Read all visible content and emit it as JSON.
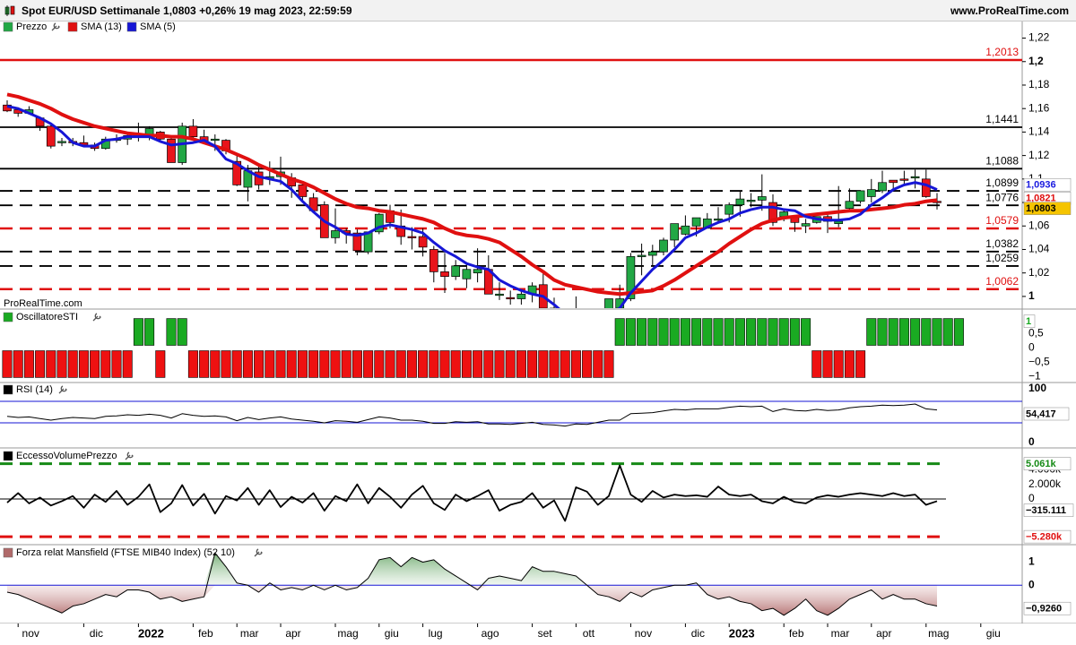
{
  "header": {
    "title": "Spot EUR/USD Settimanale 1,0803 +0,26% 19 mag 2023, 22:59:59",
    "site": "www.ProRealTime.com",
    "icon": "candlestick-icon"
  },
  "chart_data": [
    {
      "type": "candlestick",
      "panel": "price",
      "legend": [
        "Prezzo",
        "SMA (13)",
        "SMA (5)"
      ],
      "ylim": [
        0.99,
        1.225
      ],
      "y_ticks": [
        "1,22",
        "1,2",
        "1,18",
        "1,16",
        "1,14",
        "1,12",
        "1,1",
        "1,08",
        "1,06",
        "1,04",
        "1,02",
        "1"
      ],
      "y_tick_values": [
        1.22,
        1.2,
        1.18,
        1.16,
        1.14,
        1.12,
        1.1,
        1.08,
        1.06,
        1.04,
        1.02,
        1.0
      ],
      "x_labels": [
        "nov",
        "dic",
        "2022",
        "feb",
        "mar",
        "apr",
        "mag",
        "giu",
        "lug",
        "ago",
        "set",
        "ott",
        "nov",
        "dic",
        "2023",
        "feb",
        "mar",
        "apr",
        "mag",
        "giu"
      ],
      "x_label_weeks": [
        1,
        7,
        12,
        17,
        21,
        25,
        30,
        34,
        38,
        43,
        48,
        52,
        57,
        62,
        66,
        71,
        75,
        79,
        84,
        89
      ],
      "candles": [
        [
          1.163,
          1.167,
          1.157,
          1.158
        ],
        [
          1.159,
          1.161,
          1.153,
          1.156
        ],
        [
          1.156,
          1.162,
          1.155,
          1.159
        ],
        [
          1.152,
          1.153,
          1.141,
          1.145
        ],
        [
          1.145,
          1.146,
          1.126,
          1.128
        ],
        [
          1.131,
          1.135,
          1.128,
          1.132
        ],
        [
          1.132,
          1.135,
          1.128,
          1.131
        ],
        [
          1.131,
          1.137,
          1.127,
          1.129
        ],
        [
          1.129,
          1.131,
          1.124,
          1.126
        ],
        [
          1.126,
          1.136,
          1.125,
          1.134
        ],
        [
          1.133,
          1.138,
          1.131,
          1.134
        ],
        [
          1.134,
          1.139,
          1.129,
          1.137
        ],
        [
          1.137,
          1.148,
          1.132,
          1.136
        ],
        [
          1.136,
          1.145,
          1.133,
          1.143
        ],
        [
          1.14,
          1.141,
          1.132,
          1.134
        ],
        [
          1.134,
          1.136,
          1.119,
          1.114
        ],
        [
          1.114,
          1.148,
          1.112,
          1.145
        ],
        [
          1.145,
          1.151,
          1.134,
          1.136
        ],
        [
          1.136,
          1.142,
          1.13,
          1.132
        ],
        [
          1.133,
          1.138,
          1.124,
          1.134
        ],
        [
          1.133,
          1.134,
          1.121,
          1.124
        ],
        [
          1.115,
          1.121,
          1.094,
          1.095
        ],
        [
          1.093,
          1.112,
          1.081,
          1.107
        ],
        [
          1.106,
          1.111,
          1.091,
          1.095
        ],
        [
          1.1,
          1.115,
          1.095,
          1.102
        ],
        [
          1.102,
          1.119,
          1.095,
          1.106
        ],
        [
          1.101,
          1.105,
          1.084,
          1.094
        ],
        [
          1.095,
          1.096,
          1.081,
          1.085
        ],
        [
          1.084,
          1.088,
          1.072,
          1.073
        ],
        [
          1.078,
          1.081,
          1.058,
          1.05
        ],
        [
          1.05,
          1.075,
          1.045,
          1.056
        ],
        [
          1.056,
          1.058,
          1.045,
          1.054
        ],
        [
          1.054,
          1.057,
          1.035,
          1.039
        ],
        [
          1.038,
          1.055,
          1.036,
          1.055
        ],
        [
          1.055,
          1.071,
          1.053,
          1.07
        ],
        [
          1.073,
          1.078,
          1.058,
          1.063
        ],
        [
          1.06,
          1.074,
          1.044,
          1.051
        ],
        [
          1.051,
          1.059,
          1.04,
          1.05
        ],
        [
          1.051,
          1.058,
          1.034,
          1.042
        ],
        [
          1.04,
          1.043,
          1.012,
          1.021
        ],
        [
          1.021,
          1.037,
          1.003,
          1.017
        ],
        [
          1.017,
          1.031,
          1.014,
          1.026
        ],
        [
          1.015,
          1.027,
          1.007,
          1.023
        ],
        [
          1.02,
          1.041,
          1.012,
          1.023
        ],
        [
          1.023,
          1.035,
          1.002,
          1.002
        ],
        [
          1.002,
          1.012,
          0.997,
          1.002
        ],
        [
          0.999,
          1.005,
          0.993,
          0.998
        ],
        [
          0.998,
          1.006,
          0.993,
          1.002
        ],
        [
          1.002,
          1.012,
          0.995,
          1.009
        ],
        [
          1.01,
          1.02,
          1.0,
          0.99
        ],
        [
          0.99,
          0.999,
          0.983,
          0.986
        ],
        [
          0.985,
          0.988,
          0.963,
          0.97
        ],
        [
          0.98,
          1.0,
          0.97,
          0.979
        ],
        [
          0.98,
          0.988,
          0.96,
          0.974
        ],
        [
          0.975,
          0.987,
          0.966,
          0.986
        ],
        [
          0.986,
          0.998,
          0.977,
          0.998
        ],
        [
          0.99,
          1.01,
          0.985,
          0.998
        ],
        [
          0.998,
          1.037,
          0.996,
          1.034
        ],
        [
          1.034,
          1.045,
          1.018,
          1.035
        ],
        [
          1.035,
          1.044,
          1.026,
          1.038
        ],
        [
          1.038,
          1.05,
          1.035,
          1.048
        ],
        [
          1.048,
          1.061,
          1.042,
          1.062
        ],
        [
          1.053,
          1.069,
          1.052,
          1.06
        ],
        [
          1.06,
          1.067,
          1.051,
          1.067
        ],
        [
          1.058,
          1.071,
          1.058,
          1.066
        ],
        [
          1.065,
          1.076,
          1.062,
          1.066
        ],
        [
          1.07,
          1.08,
          1.063,
          1.078
        ],
        [
          1.078,
          1.09,
          1.068,
          1.083
        ],
        [
          1.081,
          1.088,
          1.076,
          1.082
        ],
        [
          1.082,
          1.104,
          1.073,
          1.085
        ],
        [
          1.08,
          1.087,
          1.06,
          1.063
        ],
        [
          1.068,
          1.074,
          1.064,
          1.072
        ],
        [
          1.068,
          1.069,
          1.055,
          1.063
        ],
        [
          1.06,
          1.066,
          1.054,
          1.062
        ],
        [
          1.063,
          1.068,
          1.062,
          1.068
        ],
        [
          1.068,
          1.072,
          1.054,
          1.064
        ],
        [
          1.062,
          1.094,
          1.059,
          1.064
        ],
        [
          1.075,
          1.092,
          1.074,
          1.081
        ],
        [
          1.081,
          1.09,
          1.079,
          1.09
        ],
        [
          1.085,
          1.1,
          1.08,
          1.091
        ],
        [
          1.09,
          1.107,
          1.088,
          1.097
        ],
        [
          1.099,
          1.099,
          1.09,
          1.097
        ],
        [
          1.1,
          1.107,
          1.096,
          1.099
        ],
        [
          1.101,
          1.108,
          1.092,
          1.102
        ],
        [
          1.1,
          1.108,
          1.084,
          1.085
        ],
        [
          1.081,
          1.088,
          1.074,
          1.08
        ]
      ],
      "sma13": [
        1.172,
        1.17,
        1.167,
        1.164,
        1.16,
        1.155,
        1.151,
        1.148,
        1.145,
        1.143,
        1.141,
        1.139,
        1.138,
        1.137,
        1.137,
        1.136,
        1.136,
        1.134,
        1.131,
        1.128,
        1.125,
        1.121,
        1.117,
        1.112,
        1.108,
        1.104,
        1.1,
        1.097,
        1.093,
        1.088,
        1.083,
        1.079,
        1.076,
        1.075,
        1.073,
        1.072,
        1.07,
        1.068,
        1.066,
        1.063,
        1.058,
        1.054,
        1.052,
        1.051,
        1.049,
        1.046,
        1.04,
        1.034,
        1.027,
        1.021,
        1.014,
        1.01,
        1.008,
        1.006,
        1.004,
        1.003,
        1.002,
        1.003,
        1.004,
        1.005,
        1.009,
        1.014,
        1.02,
        1.026,
        1.032,
        1.038,
        1.045,
        1.051,
        1.057,
        1.062,
        1.065,
        1.067,
        1.068,
        1.069,
        1.07,
        1.071,
        1.072,
        1.073,
        1.073,
        1.074,
        1.075,
        1.076,
        1.078,
        1.079,
        1.081,
        1.082
      ],
      "sma5": [
        1.162,
        1.16,
        1.156,
        1.152,
        1.147,
        1.14,
        1.131,
        1.128,
        1.128,
        1.133,
        1.134,
        1.136,
        1.136,
        1.136,
        1.132,
        1.129,
        1.13,
        1.131,
        1.133,
        1.128,
        1.117,
        1.113,
        1.107,
        1.102,
        1.1,
        1.098,
        1.091,
        1.081,
        1.072,
        1.064,
        1.059,
        1.053,
        1.052,
        1.054,
        1.059,
        1.061,
        1.059,
        1.057,
        1.054,
        1.046,
        1.039,
        1.034,
        1.028,
        1.025,
        1.023,
        1.014,
        1.009,
        1.005,
        1.002,
        1.0,
        0.993,
        0.985,
        0.981,
        0.975,
        0.979,
        0.985,
        0.99,
        1.003,
        1.013,
        1.023,
        1.031,
        1.04,
        1.05,
        1.054,
        1.059,
        1.063,
        1.066,
        1.071,
        1.074,
        1.076,
        1.076,
        1.074,
        1.073,
        1.068,
        1.066,
        1.065,
        1.065,
        1.066,
        1.07,
        1.078,
        1.084,
        1.091,
        1.095,
        1.097,
        1.095,
        1.091
      ],
      "hlines": [
        {
          "label": "1,2013",
          "value": 1.2013,
          "color": "#e01010",
          "style": "solid"
        },
        {
          "label": "1,1441",
          "value": 1.1441,
          "color": "#000000",
          "style": "solid"
        },
        {
          "label": "1,1088",
          "value": 1.1088,
          "color": "#000000",
          "style": "solid"
        },
        {
          "label": "1,0899",
          "value": 1.0899,
          "color": "#000000",
          "style": "dashed"
        },
        {
          "label": "1,0776",
          "value": 1.0776,
          "color": "#000000",
          "style": "dashed"
        },
        {
          "label": "1,0579",
          "value": 1.0579,
          "color": "#e01010",
          "style": "dashed"
        },
        {
          "label": "1,0382",
          "value": 1.0382,
          "color": "#000000",
          "style": "dashed"
        },
        {
          "label": "1,0259",
          "value": 1.0259,
          "color": "#000000",
          "style": "dashed"
        },
        {
          "label": "1,0062",
          "value": 1.0062,
          "color": "#e01010",
          "style": "dashed"
        }
      ],
      "last_values": [
        {
          "label": "1,0936",
          "value": 1.0936,
          "color": "#1a1adf"
        },
        {
          "label": "1,0821",
          "value": 1.0821,
          "color": "#e01010"
        },
        {
          "label": "1,0803",
          "value": 1.0803,
          "color": "#f5c400"
        }
      ],
      "watermark": "ProRealTime.com"
    },
    {
      "type": "bar",
      "panel": "sti",
      "legend": [
        "OscillatoreSTI"
      ],
      "y_ticks": [
        "1",
        "0,5",
        "0",
        "−0,5",
        "−1"
      ],
      "y_tick_values": [
        1,
        0.5,
        0,
        -0.5,
        -1
      ],
      "ylim": [
        -1.05,
        1.05
      ],
      "last_value": "1",
      "values": [
        -1,
        -1,
        -1,
        -1,
        -1,
        -1,
        -1,
        -1,
        -1,
        -1,
        -1,
        -1,
        1,
        1,
        -1,
        1,
        1,
        -1,
        -1,
        -1,
        -1,
        -1,
        -1,
        -1,
        -1,
        -1,
        -1,
        -1,
        -1,
        -1,
        -1,
        -1,
        -1,
        -1,
        -1,
        -1,
        -1,
        -1,
        -1,
        -1,
        -1,
        -1,
        -1,
        -1,
        -1,
        -1,
        -1,
        -1,
        -1,
        -1,
        -1,
        -1,
        -1,
        -1,
        -1,
        -1,
        1,
        1,
        1,
        1,
        1,
        1,
        1,
        1,
        1,
        1,
        1,
        1,
        1,
        1,
        1,
        1,
        1,
        1,
        -1,
        -1,
        -1,
        -1,
        -1,
        1,
        1,
        1,
        1,
        1,
        1,
        1,
        1,
        1
      ]
    },
    {
      "type": "line",
      "panel": "rsi",
      "legend": [
        "RSI (14)"
      ],
      "y_ticks": [
        "100",
        "0"
      ],
      "y_tick_values": [
        100,
        0
      ],
      "ylim": [
        0,
        100
      ],
      "levels": [
        70,
        30
      ],
      "last_value": "54,417",
      "values": [
        42,
        40,
        41,
        38,
        35,
        38,
        40,
        39,
        38,
        42,
        43,
        45,
        44,
        46,
        44,
        39,
        47,
        44,
        42,
        43,
        41,
        34,
        40,
        36,
        39,
        41,
        37,
        35,
        33,
        30,
        34,
        33,
        31,
        36,
        41,
        39,
        35,
        35,
        33,
        29,
        29,
        32,
        31,
        32,
        28,
        28,
        27,
        29,
        31,
        27,
        26,
        24,
        28,
        27,
        31,
        35,
        35,
        47,
        48,
        49,
        52,
        55,
        54,
        56,
        56,
        56,
        59,
        61,
        60,
        61,
        51,
        56,
        53,
        52,
        55,
        53,
        54,
        58,
        60,
        61,
        63,
        62,
        63,
        65,
        56,
        54
      ]
    },
    {
      "type": "line",
      "panel": "evp",
      "legend": [
        "EccessoVolumePrezzo"
      ],
      "y_ticks": [
        "4.000k",
        "2.000k",
        "0",
        "−2.000k"
      ],
      "y_tick_values": [
        4000,
        2000,
        0,
        -2000
      ],
      "ylim": [
        -6000,
        6000
      ],
      "levels": [
        5061,
        -5280
      ],
      "level_labels": [
        "5.061k",
        "−5.280k"
      ],
      "last_value": "−315.111",
      "values": [
        -500,
        800,
        -600,
        200,
        -900,
        -300,
        400,
        -1200,
        600,
        -400,
        1100,
        -800,
        300,
        2000,
        -1800,
        -600,
        1900,
        -900,
        700,
        -2000,
        400,
        -200,
        1500,
        -800,
        1200,
        -1100,
        300,
        -500,
        800,
        -1600,
        400,
        -300,
        2000,
        -600,
        1500,
        300,
        -1200,
        600,
        1800,
        -600,
        -1500,
        600,
        -300,
        400,
        1200,
        -1600,
        -800,
        -400,
        800,
        -1200,
        -200,
        -3000,
        1600,
        1000,
        -800,
        400,
        4600,
        600,
        -400,
        1100,
        200,
        600,
        400,
        500,
        300,
        1700,
        600,
        400,
        600,
        -300,
        -600,
        300,
        -400,
        -600,
        200,
        500,
        300,
        600,
        800,
        600,
        400,
        800,
        400,
        600,
        -800,
        -300
      ]
    },
    {
      "type": "area",
      "panel": "mansfield",
      "legend": [
        "Forza relat Mansfield (FTSE MIB40 Index) (52 10)"
      ],
      "y_ticks": [
        "1",
        "0",
        "−1"
      ],
      "y_tick_values": [
        1,
        0,
        -1
      ],
      "ylim": [
        -1.5,
        1.6
      ],
      "last_value": "−0,9260",
      "values": [
        -0.3,
        -0.4,
        -0.6,
        -0.8,
        -1.0,
        -1.2,
        -0.9,
        -0.8,
        -0.6,
        -0.4,
        -0.5,
        -0.2,
        -0.2,
        -0.3,
        -0.6,
        -0.5,
        -0.7,
        -0.6,
        -0.5,
        1.4,
        0.8,
        0.1,
        0.0,
        -0.3,
        0.1,
        -0.2,
        -0.1,
        -0.2,
        0.0,
        -0.2,
        0.0,
        -0.2,
        -0.1,
        0.3,
        1.1,
        1.2,
        0.8,
        1.2,
        1.0,
        1.1,
        0.7,
        0.4,
        0.1,
        -0.2,
        0.3,
        0.4,
        0.3,
        0.2,
        0.8,
        0.6,
        0.6,
        0.5,
        0.4,
        0.0,
        -0.4,
        -0.5,
        -0.7,
        -0.3,
        -0.5,
        -0.2,
        -0.1,
        0.0,
        0.0,
        0.1,
        -0.4,
        -0.6,
        -0.5,
        -0.7,
        -0.8,
        -1.1,
        -1.0,
        -1.3,
        -1.0,
        -0.6,
        -1.1,
        -1.3,
        -1.0,
        -0.6,
        -0.4,
        -0.2,
        -0.6,
        -0.4,
        -0.6,
        -0.6,
        -0.8,
        -0.9
      ]
    }
  ]
}
